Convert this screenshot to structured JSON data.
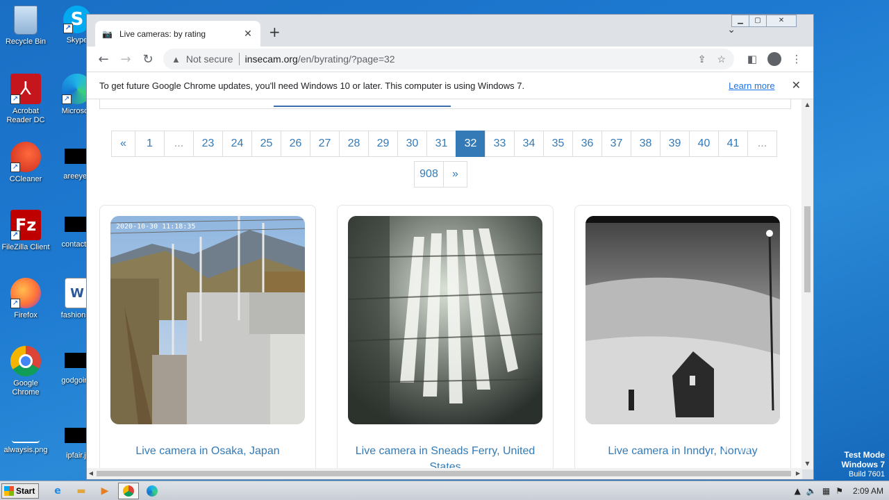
{
  "desktop": {
    "icons": [
      {
        "label": "Recycle Bin",
        "icon": "recycle-bin-icon"
      },
      {
        "label": "Skype",
        "icon": "skype-icon"
      },
      {
        "label": "Acrobat Reader DC",
        "icon": "acrobat-icon"
      },
      {
        "label": "Microsoft",
        "icon": "edge-icon"
      },
      {
        "label": "CCleaner",
        "icon": "ccleaner-icon"
      },
      {
        "label": "areeyes",
        "icon": "file-icon"
      },
      {
        "label": "FileZilla Client",
        "icon": "filezilla-icon"
      },
      {
        "label": "contactfri",
        "icon": "file-icon"
      },
      {
        "label": "Firefox",
        "icon": "firefox-icon"
      },
      {
        "label": "fashionsy",
        "icon": "word-icon"
      },
      {
        "label": "Google Chrome",
        "icon": "chrome-icon"
      },
      {
        "label": "godgoing",
        "icon": "file-icon"
      },
      {
        "label": "alwaysis.png",
        "icon": "image-icon"
      },
      {
        "label": "ipfair.jt",
        "icon": "file-icon"
      }
    ]
  },
  "browser": {
    "tab_title": "Live cameras: by rating",
    "address": {
      "security": "Not secure",
      "host": "insecam.org",
      "path": "/en/byrating/?page=32"
    },
    "infobar": {
      "message": "To get future Google Chrome updates, you'll need Windows 10 or later. This computer is using Windows 7.",
      "link": "Learn more"
    }
  },
  "pagination": {
    "row1": [
      "«",
      "1",
      "...",
      "23",
      "24",
      "25",
      "26",
      "27",
      "28",
      "29",
      "30",
      "31",
      "32",
      "33",
      "34",
      "35",
      "36",
      "37",
      "38",
      "39",
      "40",
      "41",
      "..."
    ],
    "row2": [
      "908",
      "»"
    ],
    "active": "32"
  },
  "cameras": [
    {
      "caption": "Live camera in Osaka, Japan",
      "overlay": "2020-10-30 11:18:35"
    },
    {
      "caption": "Live camera in Sneads Ferry, United States",
      "overlay": ""
    },
    {
      "caption": "Live camera in Inndyr, Norway",
      "overlay": ""
    }
  ],
  "taskbar": {
    "start": "Start",
    "clock": "2:09 AM"
  },
  "watermark": {
    "line1": "Test Mode",
    "line2": "Windows 7",
    "line3": "Build 7601",
    "brand": "ANY RUN"
  }
}
